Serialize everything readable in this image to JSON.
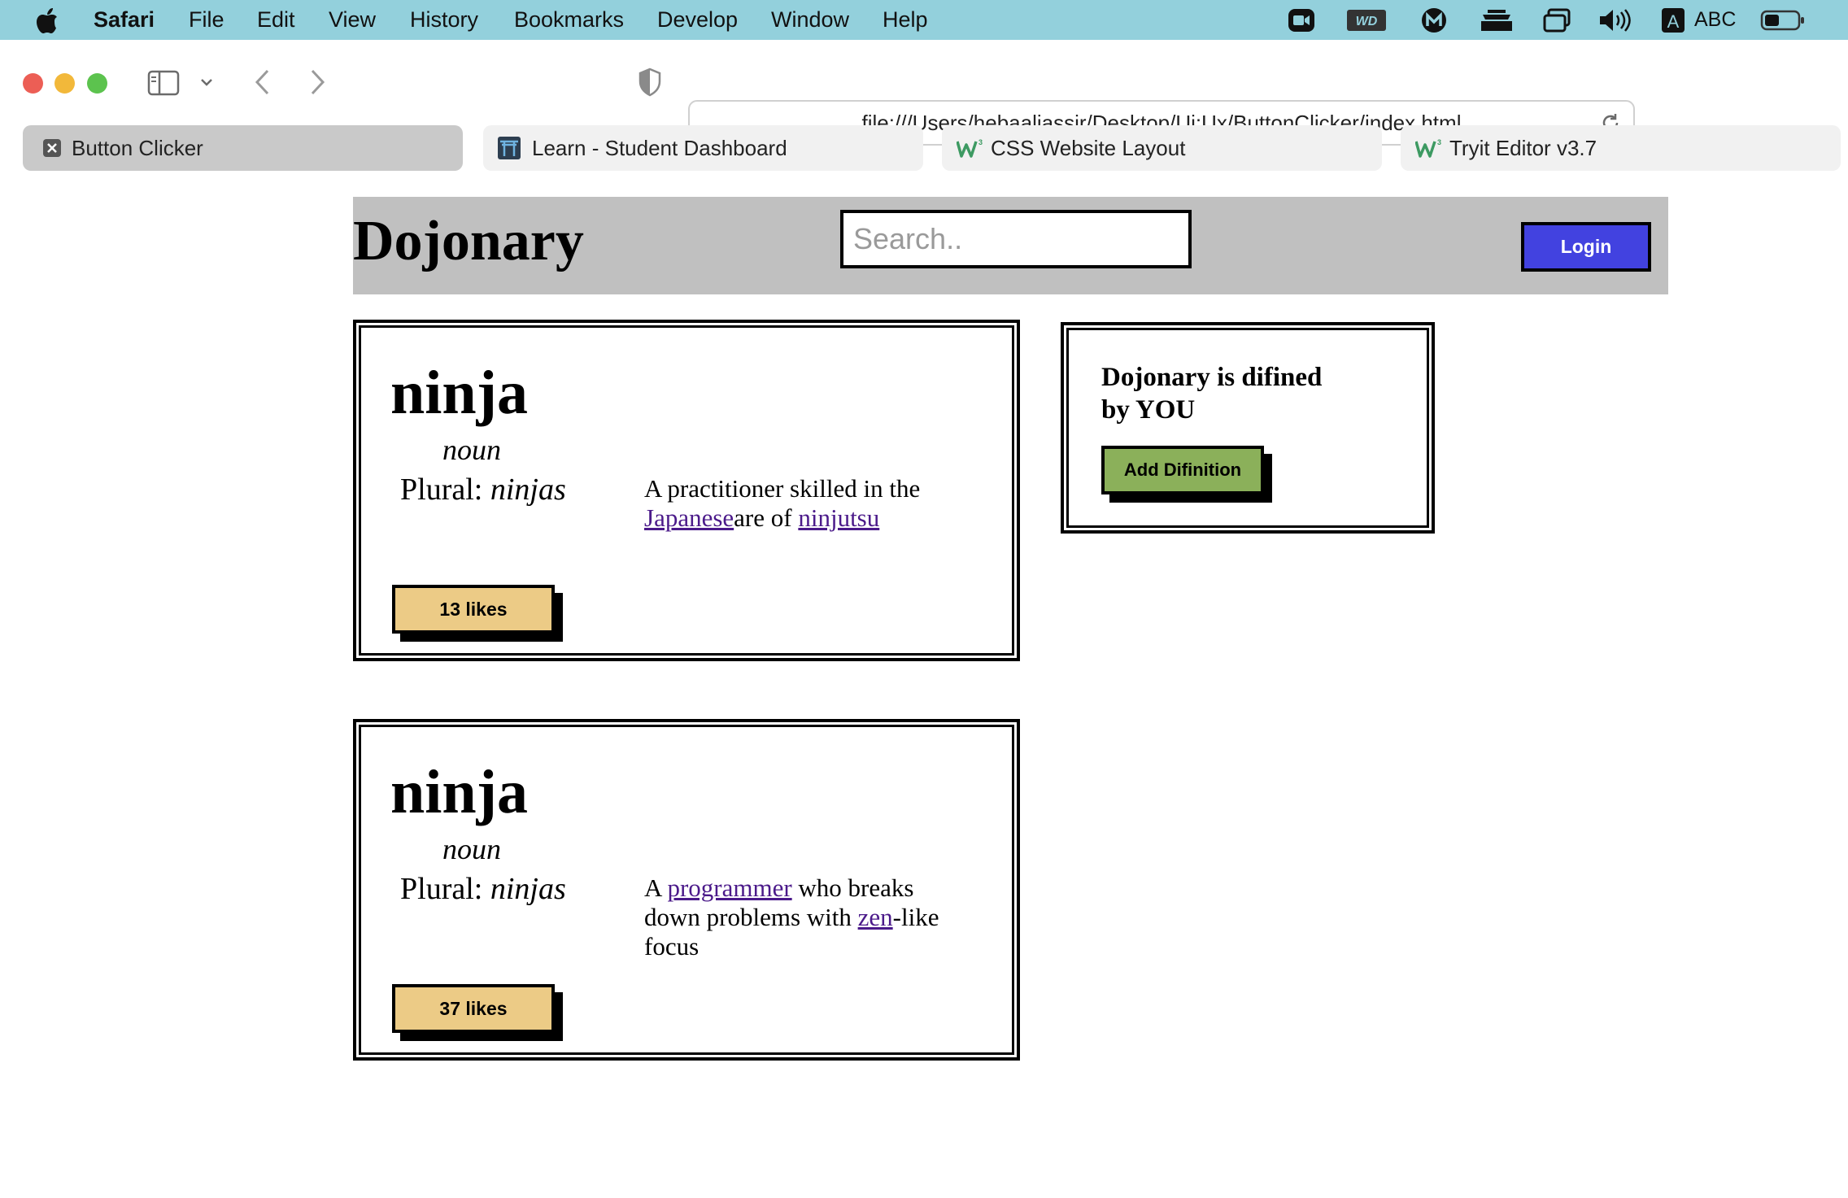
{
  "menubar": {
    "app": "Safari",
    "items": [
      "File",
      "Edit",
      "View",
      "History",
      "Bookmarks",
      "Develop",
      "Window",
      "Help"
    ],
    "input_source": "ABC"
  },
  "toolbar": {
    "url": "file:///Users/hebaaljassir/Desktop/Ui:Ux/ButtonClicker/index.html"
  },
  "tabs": [
    {
      "title": "Button Clicker",
      "icon": "close-icon",
      "active": true
    },
    {
      "title": "Learn - Student Dashboard",
      "icon": "torii-gate-icon",
      "active": false
    },
    {
      "title": "CSS Website Layout",
      "icon": "w3schools-icon",
      "active": false
    },
    {
      "title": "Tryit Editor v3.7",
      "icon": "w3schools-icon",
      "active": false
    }
  ],
  "page": {
    "brand": "Dojonary",
    "search_placeholder": "Search..",
    "login_label": "Login",
    "cards": [
      {
        "word": "ninja",
        "pos": "noun",
        "plural_label": "Plural:",
        "plural_value": "ninjas",
        "definition": {
          "t1": "A practitioner skilled in the ",
          "link1": "Japanese",
          "t2": "are of ",
          "link2": "ninjutsu",
          "t3": ""
        },
        "likes": "13 likes"
      },
      {
        "word": "ninja",
        "pos": "noun",
        "plural_label": "Plural:",
        "plural_value": "ninjas",
        "definition": {
          "t1": "A ",
          "link1": "programmer",
          "t2": " who breaks down problems with ",
          "link2": "zen",
          "t3": "-like focus"
        },
        "likes": "37 likes"
      }
    ],
    "sidebar": {
      "title": "Dojonary is difined by YOU",
      "add_label": "Add Difinition"
    }
  },
  "colors": {
    "menubar_bg": "#93d0dc",
    "header_bg": "#c0c0c0",
    "login_bg": "#4242e0",
    "like_bg": "#eccb86",
    "add_bg": "#8bb05a",
    "link": "#4b1a8a"
  }
}
